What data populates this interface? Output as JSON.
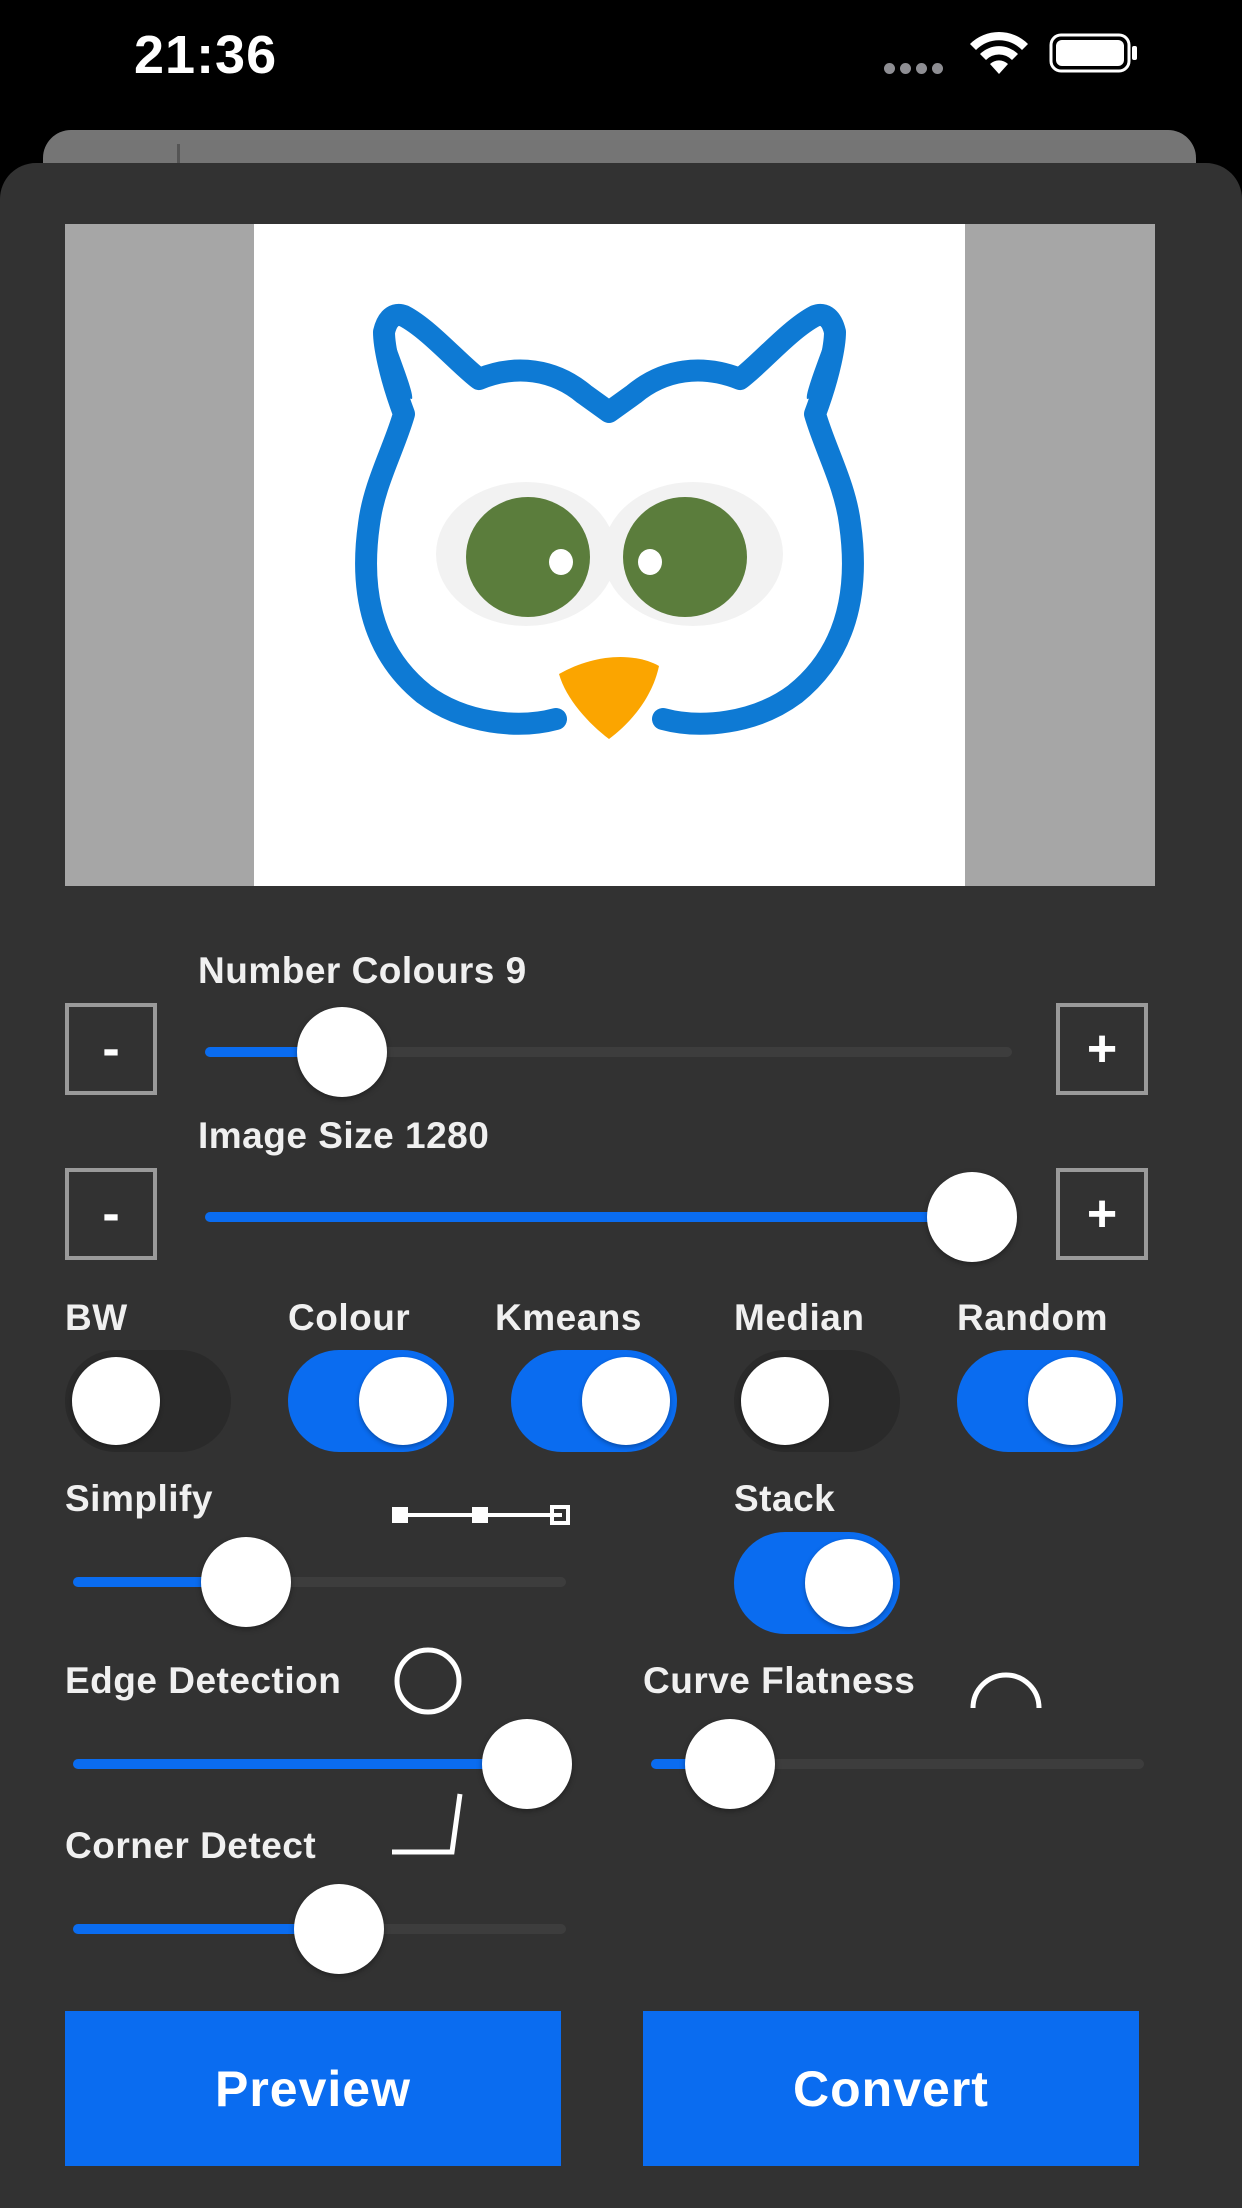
{
  "status_bar": {
    "time": "21:36"
  },
  "colors": {
    "accent": "#0a6cf0",
    "sheet": "#323232",
    "track": "#3d3d3d",
    "owl_blue": "#0e7ad4",
    "owl_eye": "#5b7d3c",
    "owl_beak": "#fba500"
  },
  "number_colours": {
    "label": "Number Colours 9",
    "minus": "-",
    "plus": "+",
    "value_fraction": 0.17
  },
  "image_size": {
    "label": "Image Size 1280",
    "minus": "-",
    "plus": "+",
    "value_fraction": 0.95
  },
  "toggles": [
    {
      "label": "BW",
      "on": false
    },
    {
      "label": "Colour",
      "on": true
    },
    {
      "label": "Kmeans",
      "on": true
    },
    {
      "label": "Median",
      "on": false
    },
    {
      "label": "Random",
      "on": true
    }
  ],
  "simplify": {
    "label": "Simplify",
    "value_fraction": 0.35,
    "icon": "path-simplify-icon"
  },
  "stack": {
    "label": "Stack",
    "on": true
  },
  "edge_detection": {
    "label": "Edge Detection",
    "value_fraction": 0.92,
    "icon": "circle-icon"
  },
  "curve_flatness": {
    "label": "Curve Flatness",
    "value_fraction": 0.16,
    "icon": "arc-icon"
  },
  "corner_detect": {
    "label": "Corner Detect",
    "value_fraction": 0.54,
    "icon": "corner-icon"
  },
  "actions": {
    "preview": "Preview",
    "convert": "Convert"
  }
}
